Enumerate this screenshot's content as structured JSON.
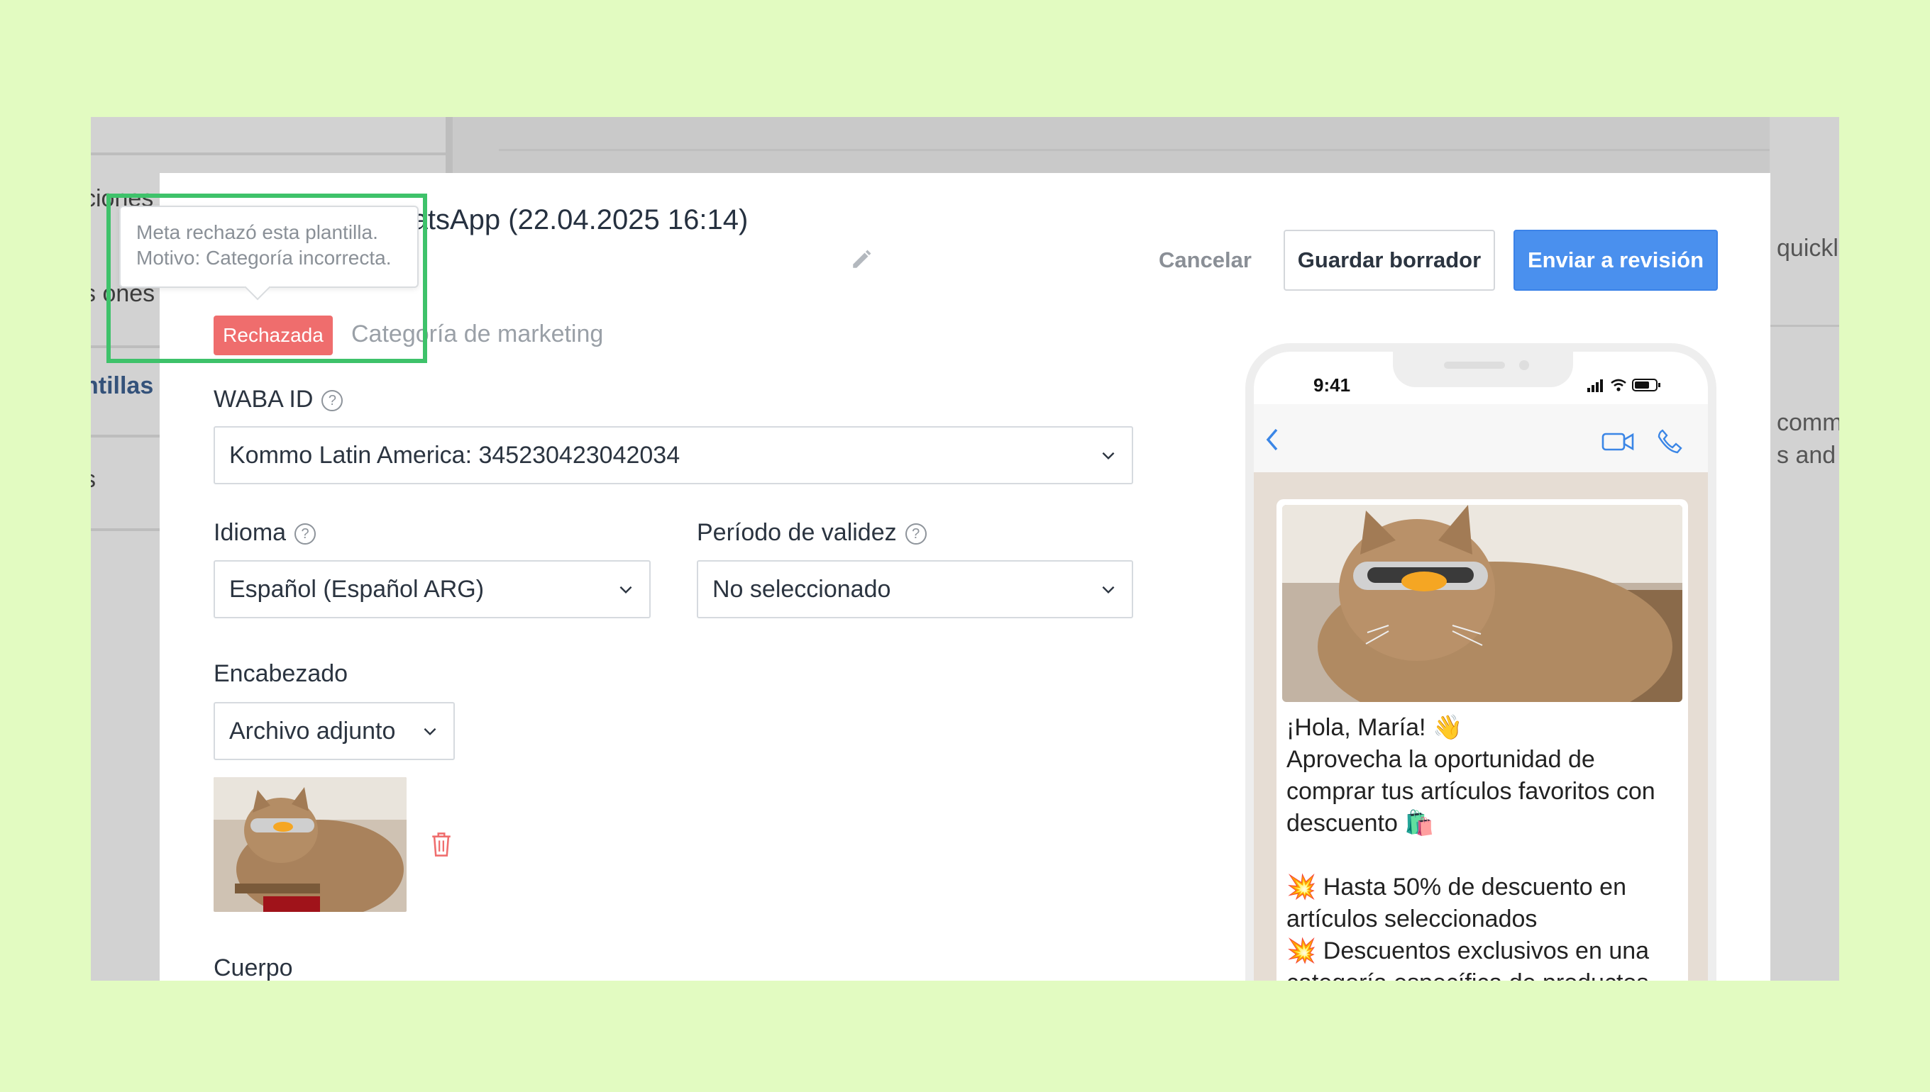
{
  "background_app": {
    "sidebar": [
      "ciones",
      "s ones",
      "ntillas",
      "s"
    ],
    "right": [
      "quickl",
      "comm",
      "s and"
    ]
  },
  "modal": {
    "title": "de WhatsApp (22.04.2025 16:14)",
    "cancel_label": "Cancelar",
    "draft_label": "Guardar borrador",
    "send_label": "Enviar a revisión",
    "status_badge": "Rechazada",
    "category": "Categoría de marketing",
    "tooltip": {
      "line1": "Meta rechazó esta plantilla.",
      "line2": "Motivo: Categoría incorrecta."
    },
    "waba": {
      "label": "WABA ID",
      "value": "Kommo Latin America: 345230423042034"
    },
    "language": {
      "label": "Idioma",
      "value": "Español (Español ARG)"
    },
    "validity": {
      "label": "Período de validez",
      "value": "No seleccionado"
    },
    "header": {
      "label": "Encabezado",
      "value": "Archivo adjunto"
    },
    "body_label": "Cuerpo"
  },
  "preview": {
    "time": "9:41",
    "message": [
      "¡Hola, María! 👋",
      "Aprovecha la oportunidad de comprar tus artículos favoritos con descuento 🛍️",
      "",
      "💥 Hasta 50% de descuento en artículos seleccionados",
      "💥 Descuentos exclusivos en una categoría específica de productos"
    ]
  },
  "colors": {
    "page_bg": "#e2fbc1",
    "accent": "#4a90ee",
    "rejected": "#ef6d6d",
    "highlight": "#3ec26a"
  },
  "icons": [
    "pencil-icon",
    "help-icon",
    "chevron-down-icon",
    "trash-icon",
    "back-icon",
    "video-icon",
    "phone-icon",
    "signal-icon",
    "wifi-icon",
    "battery-icon"
  ]
}
